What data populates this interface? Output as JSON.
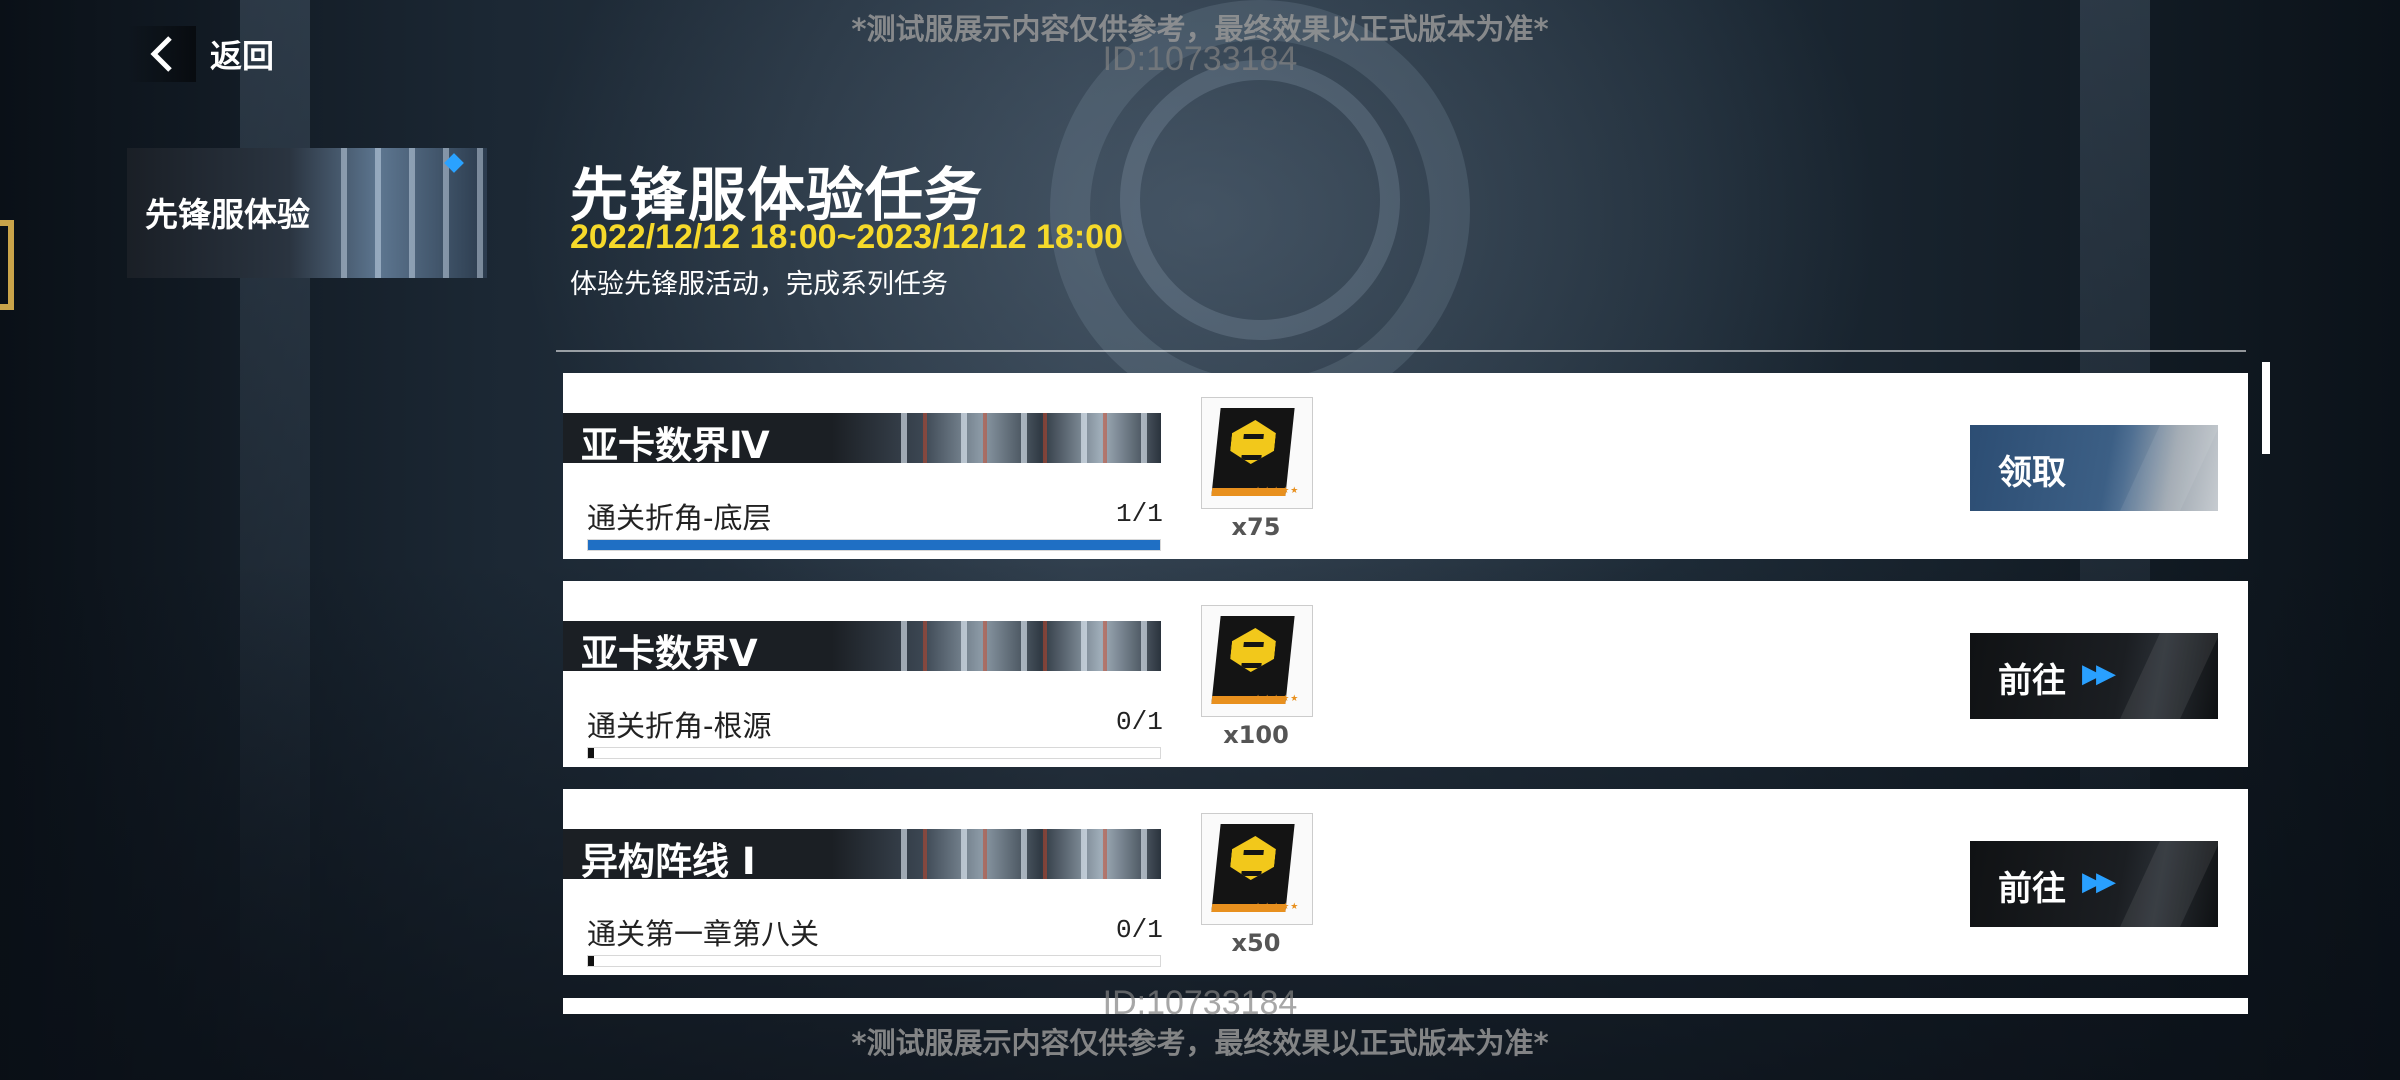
{
  "header": {
    "watermark_top": "*测试服展示内容仅供参考，最终效果以正式版本为准*",
    "watermark_id": "ID:10733184",
    "back_label": "返回"
  },
  "sidebar": {
    "tab_label": "先锋服体验"
  },
  "event": {
    "title": "先锋服体验任务",
    "date_range": "2022/12/12 18:00~2023/12/12 18:00",
    "description": "体验先锋服活动，完成系列任务"
  },
  "tasks": [
    {
      "name": "亚卡数界Ⅳ",
      "condition": "通关折角-底层",
      "progress_text": "1/1",
      "progress": 1.0,
      "reward_qty": "x75",
      "action": "领取",
      "action_type": "claim"
    },
    {
      "name": "亚卡数界Ⅴ",
      "condition": "通关折角-根源",
      "progress_text": "0/1",
      "progress": 0.0,
      "reward_qty": "x100",
      "action": "前往",
      "action_type": "goto"
    },
    {
      "name": "异构阵线 Ⅰ",
      "condition": "通关第一章第八关",
      "progress_text": "0/1",
      "progress": 0.0,
      "reward_qty": "x50",
      "action": "前往",
      "action_type": "goto"
    }
  ],
  "colors": {
    "date": "#f6d92a",
    "progress_fill": "#1f6fc4",
    "claim_button": "#2c4d73",
    "goto_button": "#101214",
    "arrow": "#29a0ff"
  },
  "icons": {
    "back": "chevron-left-icon",
    "reward": "reward-card-icon",
    "goto_arrow": "double-chevron-right-icon"
  }
}
